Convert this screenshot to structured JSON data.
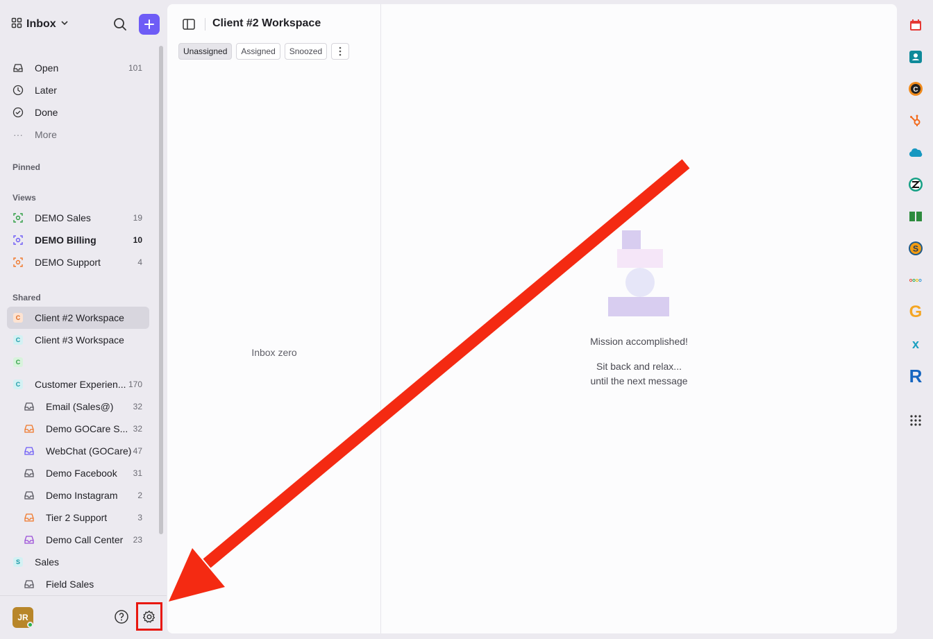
{
  "sidebar": {
    "header": {
      "title": "Inbox"
    },
    "primary": [
      {
        "label": "Open",
        "count": "101",
        "icon": "inbox-icon"
      },
      {
        "label": "Later",
        "count": "",
        "icon": "clock-icon"
      },
      {
        "label": "Done",
        "count": "",
        "icon": "check-circle-icon"
      },
      {
        "label": "More",
        "count": "",
        "icon": "ellipsis-icon"
      }
    ],
    "pinned_label": "Pinned",
    "views_label": "Views",
    "views": [
      {
        "label": "DEMO Sales",
        "count": "19",
        "color": "#2f9e44"
      },
      {
        "label": "DEMO Billing",
        "count": "10",
        "color": "#6e5cf6"
      },
      {
        "label": "DEMO Support",
        "count": "4",
        "color": "#f0782a"
      }
    ],
    "shared_label": "Shared",
    "shared": [
      {
        "label": "Client #2 Workspace",
        "count": "",
        "badge": "C",
        "badge_bg": "#fde3d2",
        "badge_fg": "#e0681d"
      },
      {
        "label": "Client #3 Workspace",
        "count": "",
        "badge": "C",
        "badge_bg": "#d3f1f3",
        "badge_fg": "#1c9aa8"
      },
      {
        "label": "",
        "count": "",
        "badge": "C",
        "badge_bg": "#d8f3dc",
        "badge_fg": "#2f9e44"
      },
      {
        "label": "Customer Experien...",
        "count": "170",
        "badge": "C",
        "badge_bg": "#d3f1f3",
        "badge_fg": "#1c9aa8"
      }
    ],
    "sub_inboxes": [
      {
        "label": "Email (Sales@)",
        "count": "32",
        "color": "#55555d"
      },
      {
        "label": "Demo GOCare S...",
        "count": "32",
        "color": "#f0782a"
      },
      {
        "label": "WebChat (GOCare)",
        "count": "47",
        "color": "#6e5cf6"
      },
      {
        "label": "Demo Facebook",
        "count": "31",
        "color": "#55555d"
      },
      {
        "label": "Demo Instagram",
        "count": "2",
        "color": "#55555d"
      },
      {
        "label": "Tier 2 Support",
        "count": "3",
        "color": "#f0782a"
      },
      {
        "label": "Demo Call Center",
        "count": "23",
        "color": "#9b4fd8"
      }
    ],
    "sales": {
      "label": "Sales",
      "badge": "S"
    },
    "field_sales": {
      "label": "Field Sales"
    },
    "footer": {
      "avatar_initials": "JR"
    }
  },
  "main": {
    "workspace_title": "Client #2 Workspace",
    "tabs": [
      "Unassigned",
      "Assigned",
      "Snoozed"
    ],
    "inbox_zero": "Inbox zero",
    "empty_title": "Mission accomplished!",
    "empty_line1": "Sit back and relax...",
    "empty_line2": "until the next message"
  },
  "rail_icons": [
    "calendar-icon",
    "contact-card-icon",
    "copper-icon",
    "hubspot-icon",
    "salesforce-icon",
    "zendesk-icon",
    "book-icon",
    "stripe-s-icon",
    "dots-color-icon",
    "g-icon",
    "x-icon",
    "r-icon",
    "apps-grid-icon"
  ],
  "colors": {
    "accent": "#6e5cf6",
    "annotation": "#e8170f"
  }
}
